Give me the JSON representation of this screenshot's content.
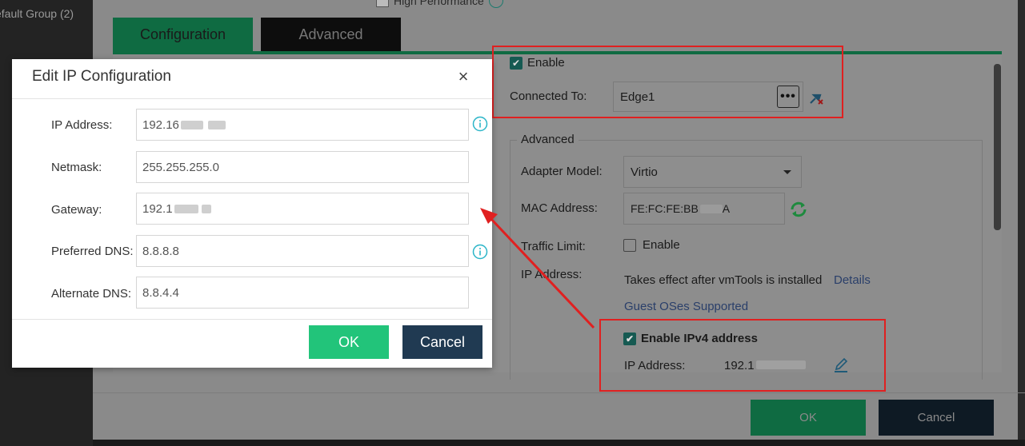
{
  "sidebar": {
    "group_label": "efault Group (2)"
  },
  "background_dialog": {
    "high_performance_label": "High Performance",
    "tabs": [
      {
        "label": "Configuration"
      },
      {
        "label": "Advanced"
      }
    ],
    "enable_label": "Enable",
    "connected_to_label": "Connected To:",
    "connected_to_value": "Edge1",
    "advanced_legend": "Advanced",
    "adapter_model_label": "Adapter Model:",
    "adapter_model_value": "Virtio",
    "mac_address_label": "MAC Address:",
    "mac_address_value": "FE:FC:FE:BB",
    "mac_address_tail": "A",
    "traffic_limit_label": "Traffic Limit:",
    "traffic_enable_label": "Enable",
    "ip_address_label": "IP Address:",
    "vmtools_note": "Takes effect after vmTools is installed",
    "details_link": "Details",
    "guest_os_link": "Guest OSes Supported",
    "enable_ipv4_label": "Enable IPv4 address",
    "ipv4_ip_label": "IP Address:",
    "ipv4_ip_value": "192.1",
    "ok_label": "OK",
    "cancel_label": "Cancel"
  },
  "modal": {
    "title": "Edit IP Configuration",
    "fields": [
      {
        "label": "IP Address:",
        "value": "192.16"
      },
      {
        "label": "Netmask:",
        "value": "255.255.255.0"
      },
      {
        "label": "Gateway:",
        "value": "192.1"
      },
      {
        "label": "Preferred DNS:",
        "value": "8.8.8.8"
      },
      {
        "label": "Alternate DNS:",
        "value": "8.8.4.4"
      }
    ],
    "ok_label": "OK",
    "cancel_label": "Cancel"
  },
  "colors": {
    "accent_green": "#22c47a",
    "dark_navy": "#203a52",
    "highlight_red": "#e02020",
    "info_teal": "#2bb5c8"
  }
}
